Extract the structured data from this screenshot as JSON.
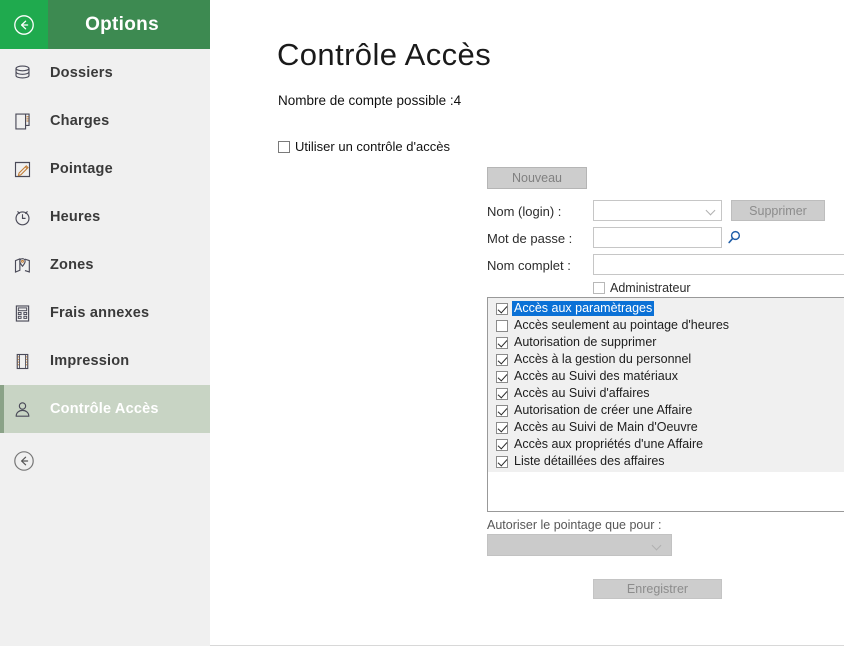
{
  "sidebar": {
    "back_icon": "circle-arrow-left-icon",
    "title": "Options",
    "items": [
      {
        "label": "Dossiers",
        "icon": "database-icon"
      },
      {
        "label": "Charges",
        "icon": "document-icon"
      },
      {
        "label": "Pointage",
        "icon": "pencil-edit-icon"
      },
      {
        "label": "Heures",
        "icon": "clock-icon"
      },
      {
        "label": "Zones",
        "icon": "map-pin-icon"
      },
      {
        "label": "Frais annexes",
        "icon": "calculator-icon"
      },
      {
        "label": "Impression",
        "icon": "printer-icon"
      },
      {
        "label": "Contrôle Accès",
        "icon": "person-icon"
      }
    ],
    "active_index": 7,
    "bottom_back_icon": "circle-arrow-left-icon"
  },
  "main": {
    "title": "Contrôle Accès",
    "account_count_text": "Nombre de compte possible :4",
    "use_access_control": {
      "label": "Utiliser un contrôle d'accès",
      "checked": false
    },
    "new_button": "Nouveau",
    "form": {
      "login_label": "Nom (login) :",
      "login_value": "",
      "delete_button": "Supprimer",
      "password_label": "Mot de passe :",
      "password_value": "",
      "search_icon": "magnifier-icon",
      "fullname_label": "Nom complet :",
      "fullname_value": "",
      "administrator": {
        "label": "Administrateur",
        "checked": false
      }
    },
    "permissions": [
      {
        "label": "Accès aux paramètrages",
        "checked": true,
        "selected": true
      },
      {
        "label": "Accès seulement au pointage d'heures",
        "checked": false,
        "selected": false
      },
      {
        "label": "Autorisation de supprimer",
        "checked": true,
        "selected": false
      },
      {
        "label": "Accès à la gestion du personnel",
        "checked": true,
        "selected": false
      },
      {
        "label": "Accès au Suivi des matériaux",
        "checked": true,
        "selected": false
      },
      {
        "label": "Accès au Suivi d'affaires",
        "checked": true,
        "selected": false
      },
      {
        "label": "Autorisation de créer une Affaire",
        "checked": true,
        "selected": false
      },
      {
        "label": "Accès au Suivi de Main d'Oeuvre",
        "checked": true,
        "selected": false
      },
      {
        "label": "Accès aux propriétés d'une Affaire",
        "checked": true,
        "selected": false
      },
      {
        "label": "Liste détaillées des affaires",
        "checked": true,
        "selected": false
      }
    ],
    "authorize_label": "Autoriser le pointage que pour :",
    "authorize_value": "",
    "save_button": "Enregistrer"
  },
  "colors": {
    "brand_green_bright": "#1faa4e",
    "brand_green_dark": "#3d8a51",
    "sidebar_bg": "#f0f0f0",
    "active_item_bg": "#c8d4c4",
    "selection_blue": "#0b71d6",
    "disabled_button_bg": "#cdcdcd"
  }
}
